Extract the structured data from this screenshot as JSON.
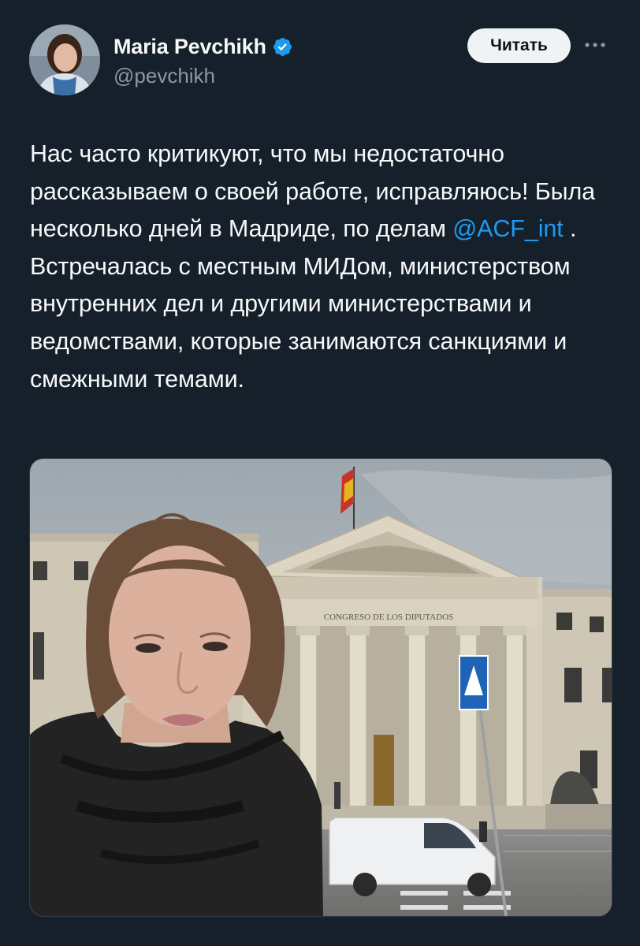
{
  "author": {
    "display_name": "Maria Pevchikh",
    "handle": "@pevchikh",
    "verified": true,
    "avatar_icon": "profile-photo"
  },
  "follow_button": {
    "label": "Читать"
  },
  "more_menu": {
    "icon": "more-horizontal-icon"
  },
  "tweet": {
    "text_before_mention": "Нас часто критикуют, что мы недостаточно рассказываем о своей работе, исправляюсь! Была несколько дней в Мадриде, по делам",
    "mention": "@ACF_int",
    "text_after_mention": " . Встречалась с местным МИДом, министерством внутренних дел и другими министерствами и ведомствами, которые занимаются санкциями и смежными темами."
  },
  "media": {
    "building_inscription": "CONGRESO DE LOS DIPUTADOS"
  },
  "colors": {
    "background": "#15202b",
    "text": "#f7f9f9",
    "secondary_text": "#8b98a5",
    "accent": "#1d9bf0",
    "button_bg": "#eff3f4"
  }
}
